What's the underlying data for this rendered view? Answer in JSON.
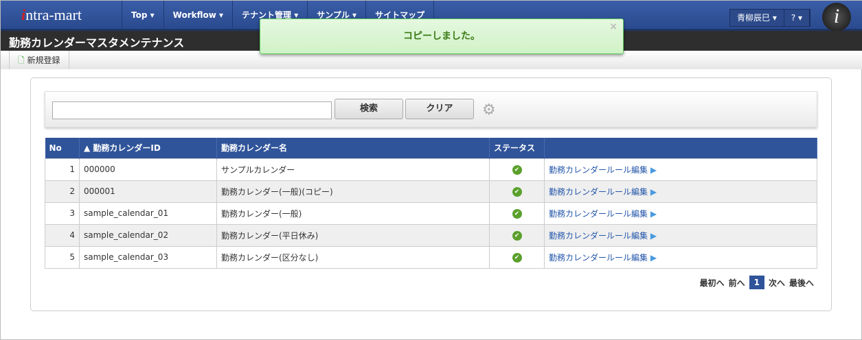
{
  "header": {
    "logo": "intra-mart",
    "menu": [
      "Top ▾",
      "Workflow ▾",
      "テナント管理 ▾",
      "サンプル ▾",
      "サイトマップ"
    ],
    "user": "青柳辰巳 ▾",
    "help": "? ▾"
  },
  "page_title": "勤務カレンダーマスタメンテナンス",
  "toolbar": {
    "new": "新規登録"
  },
  "toast": {
    "message": "コピーしました。",
    "close": "×"
  },
  "search": {
    "value": "",
    "search_label": "検索",
    "clear_label": "クリア"
  },
  "table": {
    "headers": [
      "No",
      "▲ 勤務カレンダーID",
      "勤務カレンダー名",
      "ステータス",
      ""
    ],
    "rows": [
      {
        "no": "1",
        "id": "000000",
        "name": "サンプルカレンダー",
        "link": "勤務カレンダールール編集"
      },
      {
        "no": "2",
        "id": "000001",
        "name": "勤務カレンダー(一般)(コピー)",
        "link": "勤務カレンダールール編集"
      },
      {
        "no": "3",
        "id": "sample_calendar_01",
        "name": "勤務カレンダー(一般)",
        "link": "勤務カレンダールール編集"
      },
      {
        "no": "4",
        "id": "sample_calendar_02",
        "name": "勤務カレンダー(平日休み)",
        "link": "勤務カレンダールール編集"
      },
      {
        "no": "5",
        "id": "sample_calendar_03",
        "name": "勤務カレンダー(区分なし)",
        "link": "勤務カレンダールール編集"
      }
    ]
  },
  "pager": {
    "first": "最初へ",
    "prev": "前へ",
    "current": "1",
    "next": "次へ",
    "last": "最後へ"
  }
}
